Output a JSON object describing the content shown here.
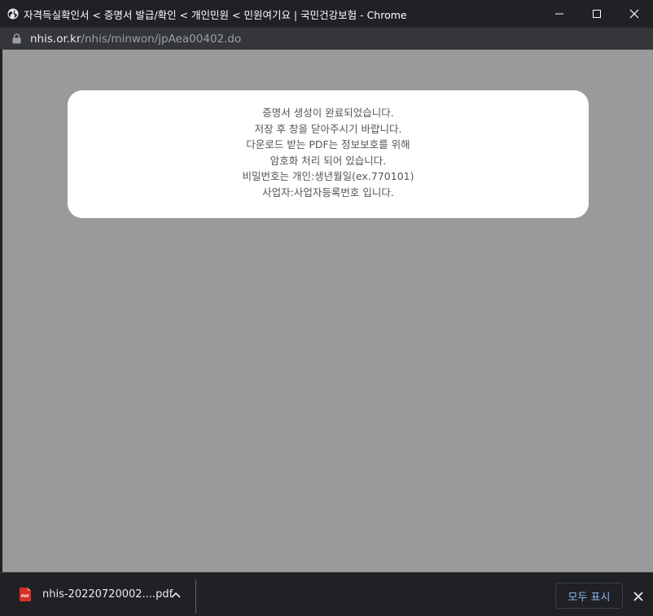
{
  "window": {
    "title": "자격득실확인서 < 증명서 발급/확인 < 개인민원 < 민원여기요 | 국민건강보험 - Chrome"
  },
  "urlbar": {
    "domain": "nhis.or.kr",
    "path": "/nhis/minwon/jpAea00402.do"
  },
  "modal": {
    "lines": [
      "증명서 생성이 완료되었습니다.",
      "저장 후 창을 닫아주시기 바랍니다.",
      "다운로드 받는 PDF는 정보보호를 위해",
      "암호화 처리 되어 있습니다.",
      "비밀번호는 개인:생년월일(ex.770101)",
      "사업자:사업자등록번호 입니다."
    ]
  },
  "downloads": {
    "file_name": "nhis-20220720002....pdf",
    "file_icon": "pdf-file-icon",
    "show_all_label": "모두 표시"
  },
  "colors": {
    "titlebar": "#202124",
    "content_bg": "#999b9b",
    "link_blue": "#8ab4f8",
    "pdf_red": "#d93025"
  }
}
